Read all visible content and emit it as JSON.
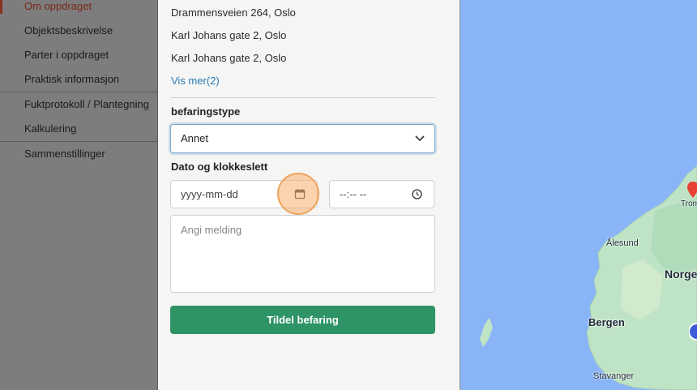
{
  "sidebar": {
    "items": [
      {
        "label": "Om oppdraget",
        "active": true
      },
      {
        "label": "Objektsbeskrivelse"
      },
      {
        "label": "Parter i oppdraget"
      },
      {
        "label": "Praktisk informasjon"
      },
      {
        "label": "Fuktprotokoll / Plantegning"
      },
      {
        "label": "Kalkulering"
      },
      {
        "label": "Sammenstillinger"
      }
    ]
  },
  "panel": {
    "addresses": [
      "Drammensveien 264, Oslo",
      "Karl Johans gate 2, Oslo",
      "Karl Johans gate 2, Oslo"
    ],
    "show_more": "Vis mer(2)",
    "inspection_type_label": "befaringstype",
    "inspection_type_value": "Annet",
    "datetime_label": "Dato og klokkeslett",
    "date_placeholder": "yyyy-mm-dd",
    "time_placeholder": "--:-- --",
    "message_placeholder": "Angi melding",
    "assign_button": "Tildel befaring"
  },
  "map": {
    "labels": {
      "alesund": "Ålesund",
      "norge": "Norge",
      "bergen": "Bergen",
      "stavanger": "Stavanger",
      "tromso": "Trom"
    }
  },
  "colors": {
    "accent_green": "#2e9466",
    "link_blue": "#2a7ab5",
    "highlight": "#f0a45c",
    "water": "#8ab4f8",
    "land": "#bfe3c5"
  }
}
